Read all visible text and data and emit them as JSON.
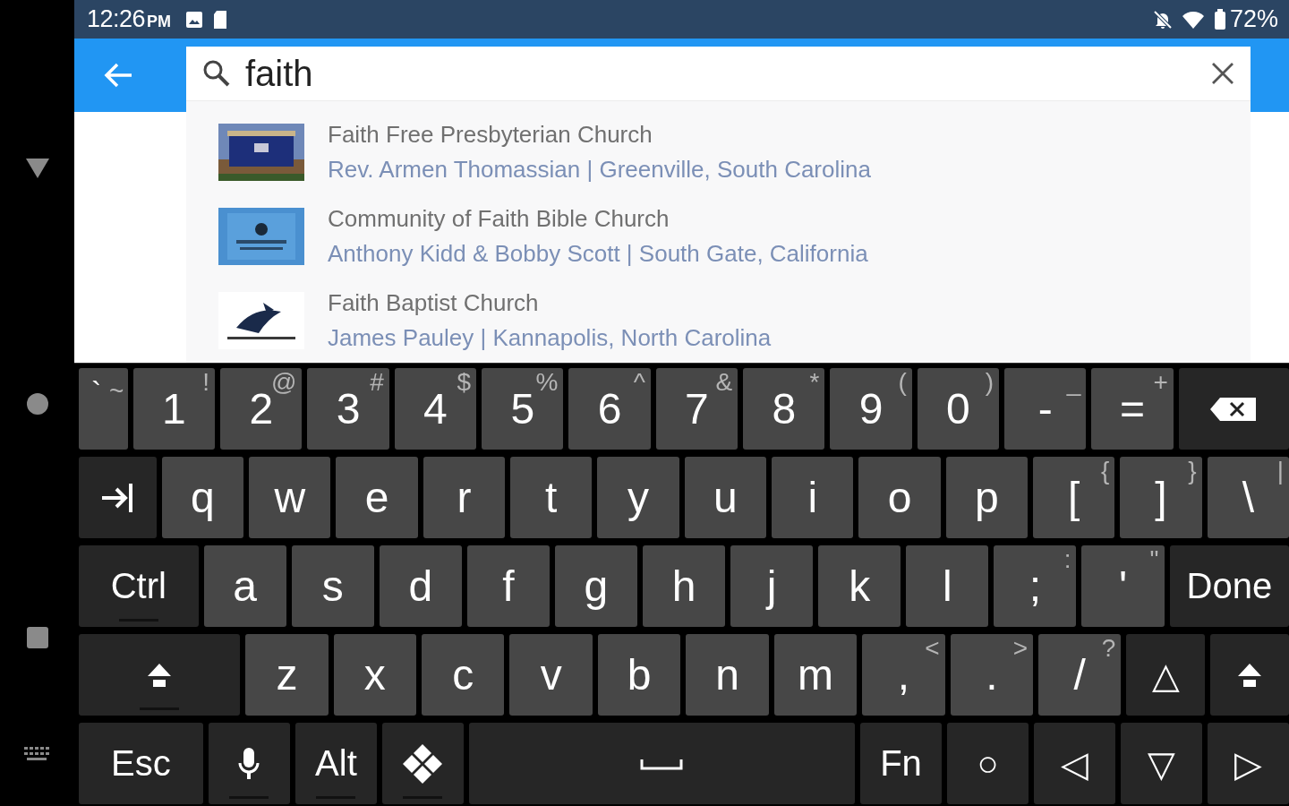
{
  "status_bar": {
    "time": "12:26",
    "meridiem": "PM",
    "battery": "72%"
  },
  "search": {
    "value": "faith"
  },
  "results": [
    {
      "title": "Faith Free Presbyterian Church",
      "subtitle": "Rev. Armen Thomassian | Greenville, South Carolina",
      "kind": "picture"
    },
    {
      "title": "Community of Faith Bible Church",
      "subtitle": "Anthony Kidd & Bobby Scott | South Gate, California",
      "kind": "picture"
    },
    {
      "title": "Faith Baptist Church",
      "subtitle": "James Pauley | Kannapolis, North Carolina",
      "kind": "picture"
    }
  ],
  "keyboard": [
    [
      {
        "kind": "char",
        "label": "`",
        "hint": "~"
      },
      {
        "kind": "char",
        "label": "1",
        "hint": "!"
      },
      {
        "kind": "char",
        "label": "2",
        "hint": "@"
      },
      {
        "kind": "char",
        "label": "3",
        "hint": "#"
      },
      {
        "kind": "char",
        "label": "4",
        "hint": "$"
      },
      {
        "kind": "char",
        "label": "5",
        "hint": "%"
      },
      {
        "kind": "char",
        "label": "6",
        "hint": "^"
      },
      {
        "kind": "char",
        "label": "7",
        "hint": "&"
      },
      {
        "kind": "char",
        "label": "8",
        "hint": "*"
      },
      {
        "kind": "char",
        "label": "9",
        "hint": "("
      },
      {
        "kind": "char",
        "label": "0",
        "hint": ")"
      },
      {
        "kind": "char",
        "label": "-",
        "hint": "_"
      },
      {
        "kind": "char",
        "label": "=",
        "hint": "+"
      },
      {
        "kind": "backspace"
      }
    ],
    [
      {
        "kind": "tab"
      },
      {
        "kind": "char",
        "label": "q"
      },
      {
        "kind": "char",
        "label": "w"
      },
      {
        "kind": "char",
        "label": "e"
      },
      {
        "kind": "char",
        "label": "r"
      },
      {
        "kind": "char",
        "label": "t"
      },
      {
        "kind": "char",
        "label": "y"
      },
      {
        "kind": "char",
        "label": "u"
      },
      {
        "kind": "char",
        "label": "i"
      },
      {
        "kind": "char",
        "label": "o"
      },
      {
        "kind": "char",
        "label": "p"
      },
      {
        "kind": "char",
        "label": "[",
        "hint": "{"
      },
      {
        "kind": "char",
        "label": "]",
        "hint": "}"
      },
      {
        "kind": "char",
        "label": "\\",
        "hint": "|"
      }
    ],
    [
      {
        "kind": "fn",
        "label": "Ctrl",
        "underline": true
      },
      {
        "kind": "char",
        "label": "a"
      },
      {
        "kind": "char",
        "label": "s"
      },
      {
        "kind": "char",
        "label": "d"
      },
      {
        "kind": "char",
        "label": "f"
      },
      {
        "kind": "char",
        "label": "g"
      },
      {
        "kind": "char",
        "label": "h"
      },
      {
        "kind": "char",
        "label": "j"
      },
      {
        "kind": "char",
        "label": "k"
      },
      {
        "kind": "char",
        "label": "l"
      },
      {
        "kind": "char",
        "label": ";",
        "hint": ":"
      },
      {
        "kind": "char",
        "label": "'",
        "hint": "\""
      },
      {
        "kind": "fn",
        "label": "Done"
      }
    ],
    [
      {
        "kind": "shift",
        "underline": true
      },
      {
        "kind": "char",
        "label": "z"
      },
      {
        "kind": "char",
        "label": "x"
      },
      {
        "kind": "char",
        "label": "c"
      },
      {
        "kind": "char",
        "label": "v"
      },
      {
        "kind": "char",
        "label": "b"
      },
      {
        "kind": "char",
        "label": "n"
      },
      {
        "kind": "char",
        "label": "m"
      },
      {
        "kind": "char",
        "label": ",",
        "hint": "<"
      },
      {
        "kind": "char",
        "label": ".",
        "hint": ">"
      },
      {
        "kind": "char",
        "label": "/",
        "hint": "?"
      },
      {
        "kind": "fn",
        "label": "△"
      },
      {
        "kind": "shift"
      }
    ],
    [
      {
        "kind": "fn",
        "label": "Esc"
      },
      {
        "kind": "mic",
        "underline": true
      },
      {
        "kind": "fn",
        "label": "Alt",
        "underline": true
      },
      {
        "kind": "diamond",
        "underline": true
      },
      {
        "kind": "space"
      },
      {
        "kind": "fn",
        "label": "Fn"
      },
      {
        "kind": "fn",
        "label": "○"
      },
      {
        "kind": "fn",
        "label": "◁"
      },
      {
        "kind": "fn",
        "label": "▽"
      },
      {
        "kind": "fn",
        "label": "▷"
      }
    ]
  ]
}
